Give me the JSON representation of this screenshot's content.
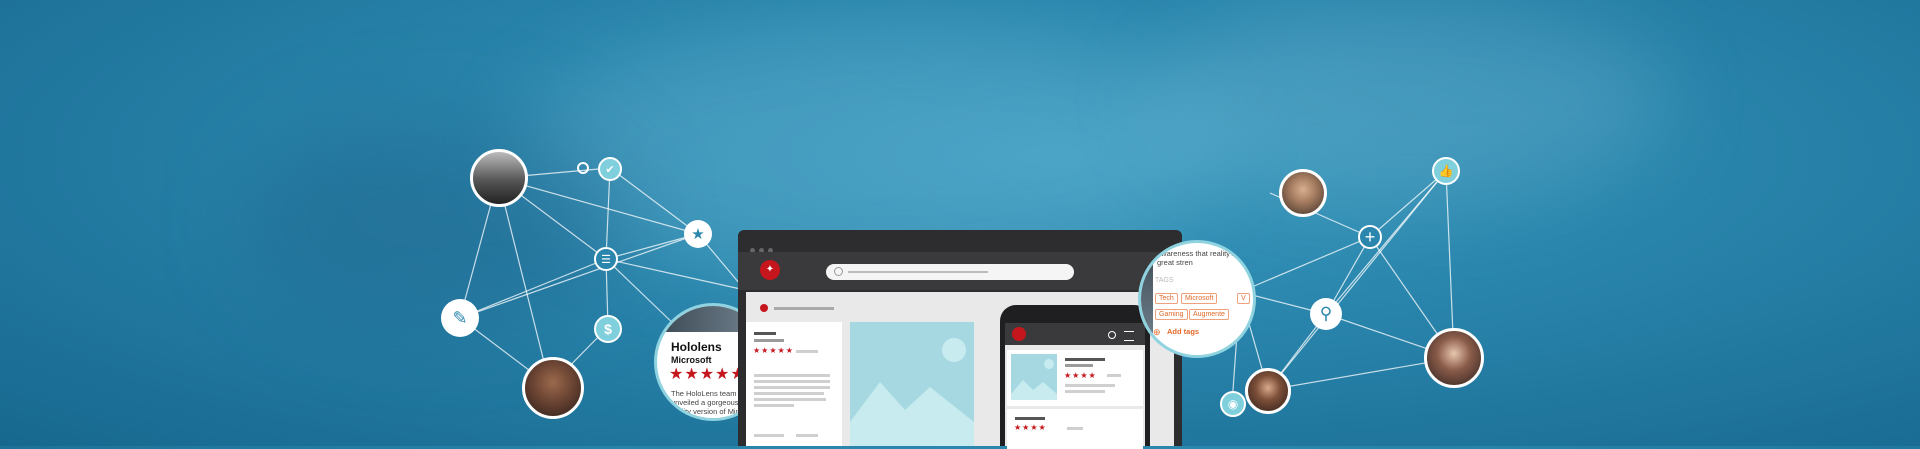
{
  "popup_product": {
    "title": "Hololens",
    "subtitle": "Microsoft",
    "stars": "★★★★★",
    "text": "The HoloLens team officially unveiled a gorgeous augm reality version of Minec osoft bought last"
  },
  "popup_tags": {
    "text": "awareness that reality's great stren",
    "tag_input": "TAGS",
    "tags": [
      "Tech",
      "Microsoft",
      "V",
      "Gaming",
      "Augmente"
    ],
    "add_label": "Add tags"
  },
  "laptop": {
    "logo": "✦",
    "card_stars": "★★★★★"
  },
  "phone": {
    "card1_stars": "★★★★",
    "card2_stars": "★★★★"
  },
  "icons": {
    "check": "✔",
    "star": "★",
    "chat": "☰",
    "dollar": "$",
    "notes": "✎",
    "plus": "+",
    "search": "⚲",
    "thumb": "👍",
    "globe": "◉"
  },
  "colors": {
    "brand_red": "#c4161c",
    "accent_teal": "#7fcfdd",
    "tag_orange": "#e36a2a",
    "background": "#2a86ad"
  }
}
